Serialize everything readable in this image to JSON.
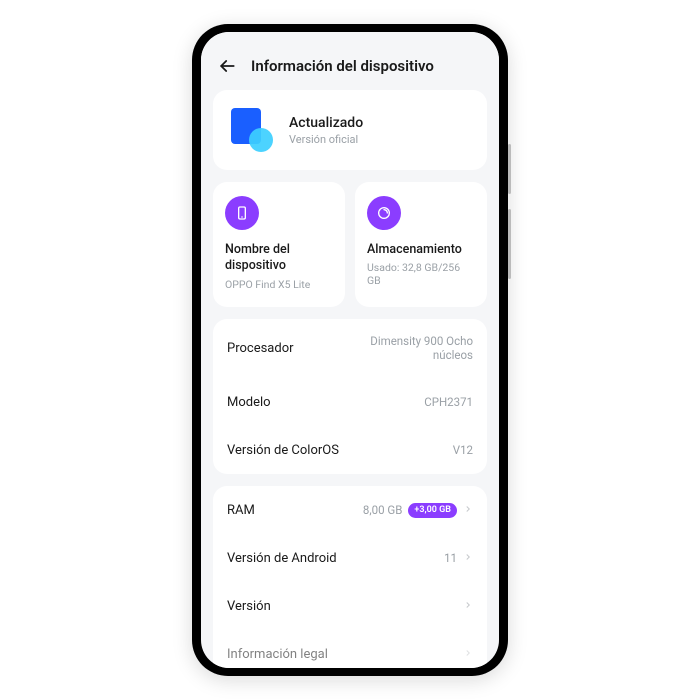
{
  "header": {
    "title": "Información del dispositivo"
  },
  "update": {
    "title": "Actualizado",
    "subtitle": "Versión oficial"
  },
  "tiles": {
    "device_name": {
      "title": "Nombre del dispositivo",
      "sub": "OPPO Find X5 Lite"
    },
    "storage": {
      "title": "Almacenamiento",
      "sub": "Usado: 32,8 GB/256 GB"
    }
  },
  "rows": {
    "processor": {
      "label": "Procesador",
      "value": "Dimensity 900 Ocho núcleos"
    },
    "model": {
      "label": "Modelo",
      "value": "CPH2371"
    },
    "coloros": {
      "label": "Versión de ColorOS",
      "value": "V12"
    },
    "ram": {
      "label": "RAM",
      "value": "8,00 GB",
      "pill": "+3,00 GB"
    },
    "android": {
      "label": "Versión de Android",
      "value": "11"
    },
    "version": {
      "label": "Versión",
      "value": ""
    },
    "legal": {
      "label": "Información legal",
      "value": ""
    }
  }
}
